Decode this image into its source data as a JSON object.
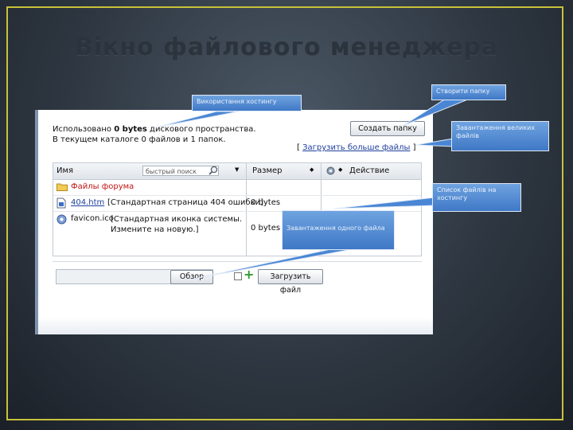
{
  "slide": {
    "title": "Вікно файлового менеджера"
  },
  "manager": {
    "usage_prefix": "Использовано ",
    "usage_bytes": "0 bytes",
    "usage_suffix": " дискового пространства.",
    "dir_summary": "В текущем каталоге 0 файлов и 1 папок.",
    "create_folder": "Создать папку",
    "more_open": "[ ",
    "more_link": "Загрузить больше файлы",
    "more_close": " ]",
    "columns": {
      "name": "Имя",
      "quick_search": "быстрый поиск",
      "size": "Размер",
      "action": "Действие"
    },
    "rows": [
      {
        "name": "Файлы форума",
        "desc": "",
        "size": "",
        "icon": "folder-icon"
      },
      {
        "name": "404.htm",
        "desc": "[Стандартная страница 404 ошибки]",
        "size": "0 bytes",
        "icon": "html-file-icon"
      },
      {
        "name": "favicon.ico",
        "desc": "[Стандартная иконка системы. Измените на новую.]",
        "size": "0 bytes",
        "icon": "ico-file-icon"
      }
    ],
    "browse": "Обзор",
    "upload": "Загрузить файл"
  },
  "callouts": [
    {
      "text": "Використання хостингу"
    },
    {
      "text": "Створити папку"
    },
    {
      "text": "Завантаження великих файлів"
    },
    {
      "text": "Список файлів на хостингу"
    },
    {
      "text": "Завантаження одного файла"
    }
  ],
  "colors": {
    "callout": "#4a86d4",
    "link": "#1f3f9e",
    "folder_text": "#c01515",
    "frame": "#c8c23a"
  }
}
